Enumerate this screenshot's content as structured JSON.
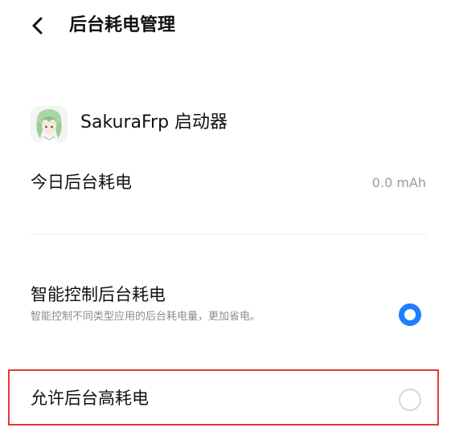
{
  "header": {
    "back_icon": "chevron-left-icon",
    "title": "后台耗电管理"
  },
  "app": {
    "icon": "app-icon-anime-character",
    "name": "SakuraFrp 启动器"
  },
  "usage": {
    "label": "今日后台耗电",
    "value": "0.0 mAh"
  },
  "options": {
    "smart": {
      "title": "智能控制后台耗电",
      "description": "智能控制不同类型应用的后台耗电量，更加省电。",
      "selected": true
    },
    "allow_high": {
      "title": "允许后台高耗电",
      "selected": false
    }
  },
  "colors": {
    "accent": "#1f7dff",
    "highlight_border": "#e53935",
    "secondary_text": "#9b9b9b"
  }
}
